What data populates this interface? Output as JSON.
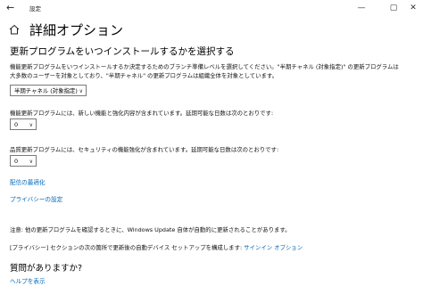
{
  "window": {
    "title": "設定",
    "back_icon": "back-arrow-icon",
    "controls": [
      "minimize-icon",
      "maximize-icon",
      "close-icon"
    ]
  },
  "page": {
    "home_icon": "home-icon",
    "title": "詳細オプション"
  },
  "section": {
    "heading": "更新プログラムをいつインストールするかを選択する",
    "desc_line1": "機能更新プログラムをいつインストールするか決定するためのブランチ準備レベルを選択してください。\"半期チャネル (対象指定)\" の更新プログラムは",
    "desc_line2": "大多数のユーザーを対象としており、\"半期チャネル\" の更新プログラムは組織全体を対象としています。",
    "channel_select_value": "半期チャネル (対象指定)",
    "feature_label": "機能更新プログラムには、新しい機能と強化内容が含まれています。延期可能な日数は次のとおりです:",
    "feature_select_value": "0",
    "quality_label": "品質更新プログラムには、セキュリティの機能強化が含まれています。延期可能な日数は次のとおりです:",
    "quality_select_value": "0"
  },
  "links": {
    "delivery_optimization": "配信の最適化",
    "privacy_settings": "プライバシーの設定"
  },
  "notes": {
    "note1": "注意: 他の更新プログラムを確認するときに、Windows Update 自体が自動的に更新されることがあります。",
    "note2_text": "[プライバシー] セクションの次の箇所で更新後の自動デバイス セットアップを構成します: ",
    "note2_link": "サインイン オプション"
  },
  "help": {
    "heading": "質問がありますか?",
    "link": "ヘルプを表示"
  },
  "colors": {
    "link": "#0067b8",
    "background": "#ffffff"
  }
}
